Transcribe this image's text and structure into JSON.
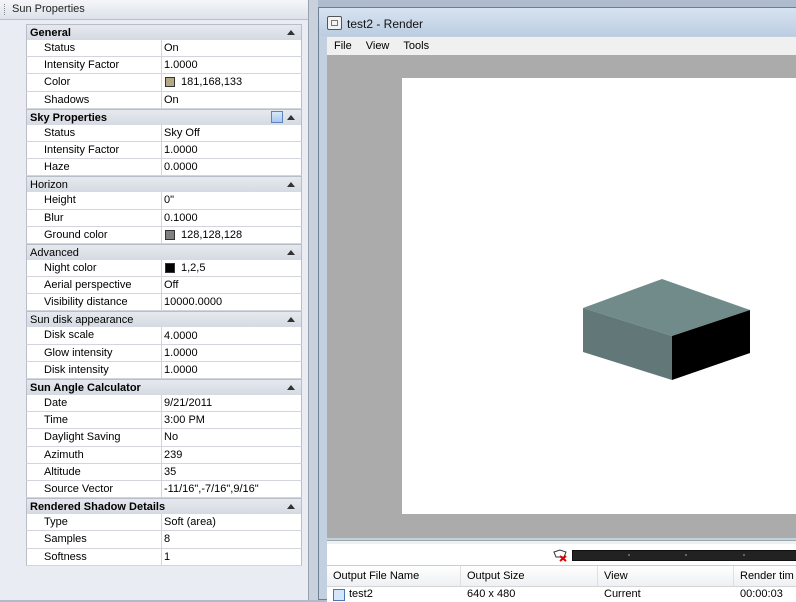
{
  "palette": {
    "title": "Sun Properties",
    "sections": [
      {
        "title": "General",
        "bold": true,
        "env_icon": false,
        "rows": [
          {
            "label": "Status",
            "value": "On"
          },
          {
            "label": "Intensity Factor",
            "value": "1.0000"
          },
          {
            "label": "Color",
            "value": "181,168,133",
            "swatch": "#b5a885"
          },
          {
            "label": "Shadows",
            "value": "On"
          }
        ]
      },
      {
        "title": "Sky Properties",
        "bold": true,
        "env_icon": true,
        "rows": [
          {
            "label": "Status",
            "value": "Sky Off"
          },
          {
            "label": "Intensity Factor",
            "value": "1.0000"
          },
          {
            "label": "Haze",
            "value": "0.0000"
          }
        ]
      },
      {
        "title": "Horizon",
        "bold": false,
        "env_icon": false,
        "rows": [
          {
            "label": "Height",
            "value": "0\""
          },
          {
            "label": "Blur",
            "value": "0.1000"
          },
          {
            "label": "Ground color",
            "value": "128,128,128",
            "swatch": "#808080"
          }
        ]
      },
      {
        "title": "Advanced",
        "bold": false,
        "env_icon": false,
        "rows": [
          {
            "label": "Night color",
            "value": "1,2,5",
            "swatch": "#010205"
          },
          {
            "label": "Aerial perspective",
            "value": "Off"
          },
          {
            "label": "Visibility distance",
            "value": "10000.0000"
          }
        ]
      },
      {
        "title": "Sun disk appearance",
        "bold": false,
        "env_icon": false,
        "rows": [
          {
            "label": "Disk scale",
            "value": "4.0000"
          },
          {
            "label": "Glow intensity",
            "value": "1.0000"
          },
          {
            "label": "Disk intensity",
            "value": "1.0000"
          }
        ]
      },
      {
        "title": "Sun Angle Calculator",
        "bold": true,
        "env_icon": false,
        "rows": [
          {
            "label": "Date",
            "value": "9/21/2011"
          },
          {
            "label": "Time",
            "value": "3:00 PM"
          },
          {
            "label": "Daylight Saving",
            "value": "No"
          },
          {
            "label": "Azimuth",
            "value": "239"
          },
          {
            "label": "Altitude",
            "value": "35"
          },
          {
            "label": "Source Vector",
            "value": "-11/16\",-7/16\",9/16\""
          }
        ]
      },
      {
        "title": "Rendered Shadow Details",
        "bold": true,
        "env_icon": false,
        "rows": [
          {
            "label": "Type",
            "value": "Soft (area)"
          },
          {
            "label": "Samples",
            "value": "8"
          },
          {
            "label": "Softness",
            "value": "1"
          }
        ]
      }
    ]
  },
  "render_window": {
    "title": "test2 - Render",
    "menu": [
      "File",
      "View",
      "Tools"
    ],
    "cube_colors": {
      "top": "#718a8a",
      "left": "#627878",
      "right": "#000000"
    },
    "list": {
      "headers": [
        "Output File Name",
        "Output Size",
        "View",
        "Render tim"
      ],
      "rows": [
        {
          "file": "test2",
          "size": "640 x 480",
          "view": "Current",
          "time": "00:00:03"
        }
      ]
    }
  }
}
